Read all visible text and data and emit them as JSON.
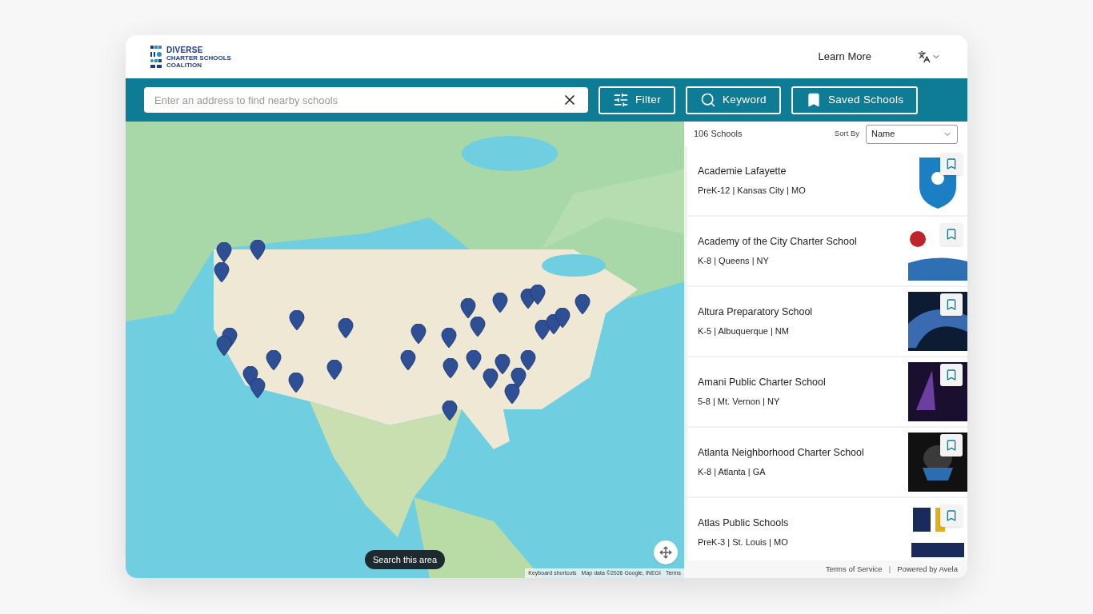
{
  "header": {
    "logo": [
      "DIVERSE",
      "CHARTER SCHOOLS",
      "COALITION"
    ],
    "learn_more": "Learn More"
  },
  "search": {
    "placeholder": "Enter an address to find nearby schools"
  },
  "toolbar_buttons": [
    {
      "kind": "filter",
      "label": "Filter"
    },
    {
      "kind": "keyword",
      "label": "Keyword"
    },
    {
      "kind": "saved",
      "label": "Saved Schools"
    }
  ],
  "map": {
    "search_area": "Search this area",
    "attribution": [
      "Keyboard shortcuts",
      "Map data ©2026 Google, INEGI",
      "Terms"
    ]
  },
  "results": {
    "count": "106 Schools",
    "sort_label": "Sort By",
    "sort_value": "Name"
  },
  "schools": [
    {
      "name": "Academie Lafayette",
      "details": "PreK-12 | Kansas City | MO",
      "saved": false
    },
    {
      "name": "Academy of the City Charter School",
      "details": "K-8 | Queens | NY",
      "saved": false
    },
    {
      "name": "Altura Preparatory School",
      "details": "K-5 | Albuquerque | NM",
      "saved": false
    },
    {
      "name": "Amani Public Charter School",
      "details": "5-8 | Mt. Vernon | NY",
      "saved": false
    },
    {
      "name": "Atlanta Neighborhood Charter School",
      "details": "K-8 | Atlanta | GA",
      "saved": false
    },
    {
      "name": "Atlas Public Schools",
      "details": "PreK-3 | St. Louis | MO",
      "saved": false
    }
  ],
  "footer": {
    "links": [
      "Terms of Service",
      "Powered by Avela"
    ],
    "separator": "|"
  }
}
